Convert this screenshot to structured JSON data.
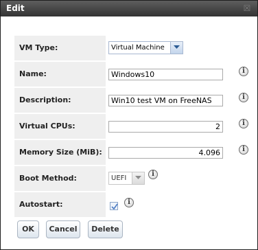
{
  "dialog": {
    "title": "Edit"
  },
  "fields": {
    "vm_type": {
      "label": "VM Type:",
      "value": "Virtual Machine"
    },
    "name": {
      "label": "Name:",
      "value": "Windows10"
    },
    "description": {
      "label": "Description:",
      "value": "Win10 test VM on FreeNAS"
    },
    "vcpus": {
      "label": "Virtual CPUs:",
      "value": "2"
    },
    "memory": {
      "label": "Memory Size (MiB):",
      "value": "4.096"
    },
    "boot_method": {
      "label": "Boot Method:",
      "value": "UEFI"
    },
    "autostart": {
      "label": "Autostart:",
      "checked": true
    }
  },
  "buttons": {
    "ok": "OK",
    "cancel": "Cancel",
    "delete": "Delete"
  },
  "icons": {
    "help": "info-icon",
    "close": "close-icon"
  }
}
